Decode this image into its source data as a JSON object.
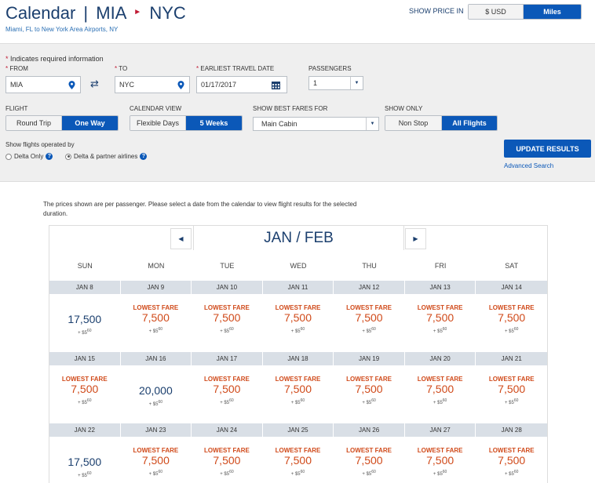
{
  "header": {
    "title_prefix": "Calendar",
    "title_sep": "|",
    "origin": "MIA",
    "destination": "NYC",
    "route_text": "Miami, FL to New York Area Airports, NY",
    "show_price_label": "SHOW PRICE IN",
    "price_options": [
      "$ USD",
      "Miles"
    ],
    "price_selected": "Miles"
  },
  "form": {
    "required_note": "Indicates required information",
    "from_label": "FROM",
    "from_value": "MIA",
    "to_label": "TO",
    "to_value": "NYC",
    "date_label": "EARLIEST TRAVEL DATE",
    "date_value": "01/17/2017",
    "passengers_label": "PASSENGERS",
    "passengers_value": "1",
    "flight_label": "FLIGHT",
    "flight_options": [
      "Round Trip",
      "One Way"
    ],
    "flight_selected": "One Way",
    "calview_label": "CALENDAR VIEW",
    "calview_options": [
      "Flexible Days",
      "5 Weeks"
    ],
    "calview_selected": "5 Weeks",
    "bestfare_label": "SHOW BEST FARES FOR",
    "bestfare_value": "Main Cabin",
    "showonly_label": "SHOW ONLY",
    "showonly_options": [
      "Non Stop",
      "All Flights"
    ],
    "showonly_selected": "All Flights",
    "operated_label": "Show flights operated by",
    "operated_options": [
      "Delta Only",
      "Delta & partner airlines"
    ],
    "operated_selected": "Delta & partner airlines",
    "update_button": "UPDATE RESULTS",
    "advanced_link": "Advanced Search"
  },
  "notice": "The prices shown are per passenger. Please select a date from the calendar to view flight results for the selected duration.",
  "calendar": {
    "month_title": "JAN / FEB",
    "days_of_week": [
      "SUN",
      "MON",
      "TUE",
      "WED",
      "THU",
      "FRI",
      "SAT"
    ],
    "lowest_label": "LOWEST FARE",
    "tax_prefix": "+ $",
    "tax_dollars": "5",
    "tax_cents": "60",
    "weeks": [
      [
        {
          "date": "JAN 8",
          "price": "17,500",
          "lowest": false
        },
        {
          "date": "JAN 9",
          "price": "7,500",
          "lowest": true
        },
        {
          "date": "JAN 10",
          "price": "7,500",
          "lowest": true
        },
        {
          "date": "JAN 11",
          "price": "7,500",
          "lowest": true
        },
        {
          "date": "JAN 12",
          "price": "7,500",
          "lowest": true
        },
        {
          "date": "JAN 13",
          "price": "7,500",
          "lowest": true
        },
        {
          "date": "JAN 14",
          "price": "7,500",
          "lowest": true
        }
      ],
      [
        {
          "date": "JAN 15",
          "price": "7,500",
          "lowest": true
        },
        {
          "date": "JAN 16",
          "price": "20,000",
          "lowest": false
        },
        {
          "date": "JAN 17",
          "price": "7,500",
          "lowest": true
        },
        {
          "date": "JAN 18",
          "price": "7,500",
          "lowest": true
        },
        {
          "date": "JAN 19",
          "price": "7,500",
          "lowest": true
        },
        {
          "date": "JAN 20",
          "price": "7,500",
          "lowest": true
        },
        {
          "date": "JAN 21",
          "price": "7,500",
          "lowest": true
        }
      ],
      [
        {
          "date": "JAN 22",
          "price": "17,500",
          "lowest": false
        },
        {
          "date": "JAN 23",
          "price": "7,500",
          "lowest": true
        },
        {
          "date": "JAN 24",
          "price": "7,500",
          "lowest": true
        },
        {
          "date": "JAN 25",
          "price": "7,500",
          "lowest": true
        },
        {
          "date": "JAN 26",
          "price": "7,500",
          "lowest": true
        },
        {
          "date": "JAN 27",
          "price": "7,500",
          "lowest": true
        },
        {
          "date": "JAN 28",
          "price": "7,500",
          "lowest": true
        }
      ]
    ]
  },
  "colors": {
    "brand_navy": "#1b3f6e",
    "accent_blue": "#0b58b8",
    "lowest_fare_orange": "#d04a1a",
    "required_red": "#c01933"
  },
  "icons": [
    "location-pin-icon",
    "swap-arrows-icon",
    "calendar-icon",
    "chevron-down-icon",
    "help-icon",
    "triangle-left-icon",
    "triangle-right-icon"
  ]
}
